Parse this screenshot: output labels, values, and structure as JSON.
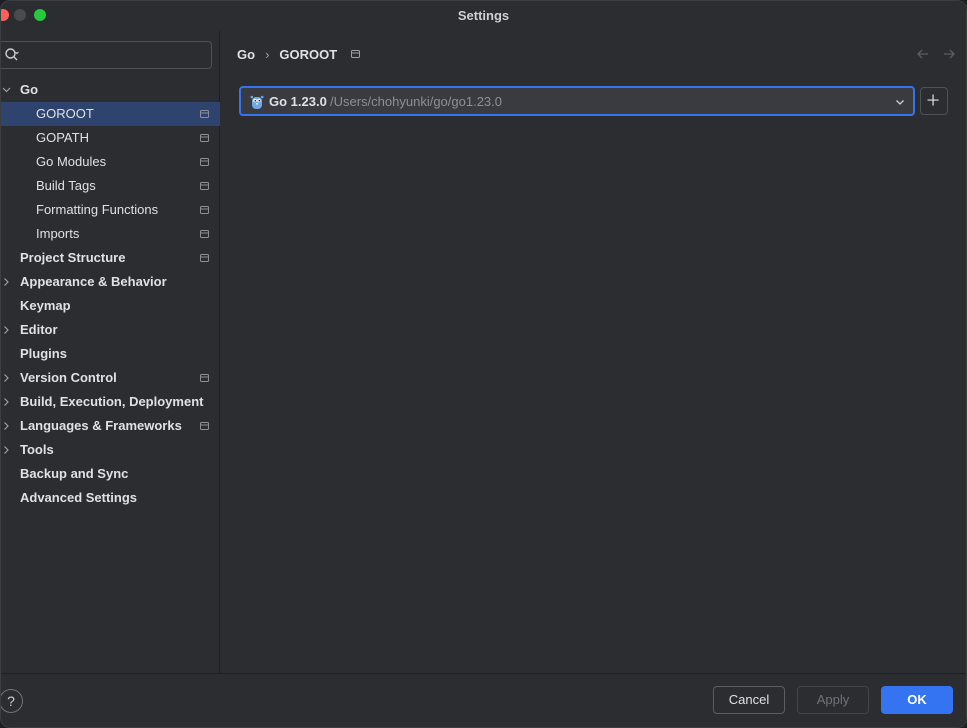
{
  "window": {
    "title": "Settings"
  },
  "search": {
    "placeholder": ""
  },
  "sidebar": {
    "items": [
      {
        "label": "Go",
        "level": 0,
        "expanded": true,
        "bold": true,
        "chevron": "down",
        "project": false,
        "selected": false
      },
      {
        "label": "GOROOT",
        "level": 1,
        "bold": false,
        "chevron": "none",
        "project": true,
        "selected": true
      },
      {
        "label": "GOPATH",
        "level": 1,
        "bold": false,
        "chevron": "none",
        "project": true,
        "selected": false
      },
      {
        "label": "Go Modules",
        "level": 1,
        "bold": false,
        "chevron": "none",
        "project": true,
        "selected": false
      },
      {
        "label": "Build Tags",
        "level": 1,
        "bold": false,
        "chevron": "none",
        "project": true,
        "selected": false
      },
      {
        "label": "Formatting Functions",
        "level": 1,
        "bold": false,
        "chevron": "none",
        "project": true,
        "selected": false
      },
      {
        "label": "Imports",
        "level": 1,
        "bold": false,
        "chevron": "none",
        "project": true,
        "selected": false
      },
      {
        "label": "Project Structure",
        "level": 0,
        "bold": true,
        "chevron": "none",
        "project": true,
        "selected": false
      },
      {
        "label": "Appearance & Behavior",
        "level": 0,
        "bold": true,
        "chevron": "right",
        "project": false,
        "selected": false
      },
      {
        "label": "Keymap",
        "level": 0,
        "bold": true,
        "chevron": "none",
        "project": false,
        "selected": false
      },
      {
        "label": "Editor",
        "level": 0,
        "bold": true,
        "chevron": "right",
        "project": false,
        "selected": false
      },
      {
        "label": "Plugins",
        "level": 0,
        "bold": true,
        "chevron": "none",
        "project": false,
        "selected": false
      },
      {
        "label": "Version Control",
        "level": 0,
        "bold": true,
        "chevron": "right",
        "project": true,
        "selected": false
      },
      {
        "label": "Build, Execution, Deployment",
        "level": 0,
        "bold": true,
        "chevron": "right",
        "project": false,
        "selected": false
      },
      {
        "label": "Languages & Frameworks",
        "level": 0,
        "bold": true,
        "chevron": "right",
        "project": true,
        "selected": false
      },
      {
        "label": "Tools",
        "level": 0,
        "bold": true,
        "chevron": "right",
        "project": false,
        "selected": false
      },
      {
        "label": "Backup and Sync",
        "level": 0,
        "bold": true,
        "chevron": "none",
        "project": false,
        "selected": false
      },
      {
        "label": "Advanced Settings",
        "level": 0,
        "bold": true,
        "chevron": "none",
        "project": false,
        "selected": false
      }
    ]
  },
  "breadcrumb": {
    "parent": "Go",
    "separator": "›",
    "current": "GOROOT"
  },
  "goroot": {
    "sdk_version": "Go 1.23.0",
    "sdk_path": "/Users/chohyunki/go/go1.23.0"
  },
  "footer": {
    "help_label": "?",
    "cancel_label": "Cancel",
    "apply_label": "Apply",
    "ok_label": "OK"
  },
  "colors": {
    "accent": "#3574f0",
    "selection": "#2e436e",
    "background": "#2b2d30"
  }
}
